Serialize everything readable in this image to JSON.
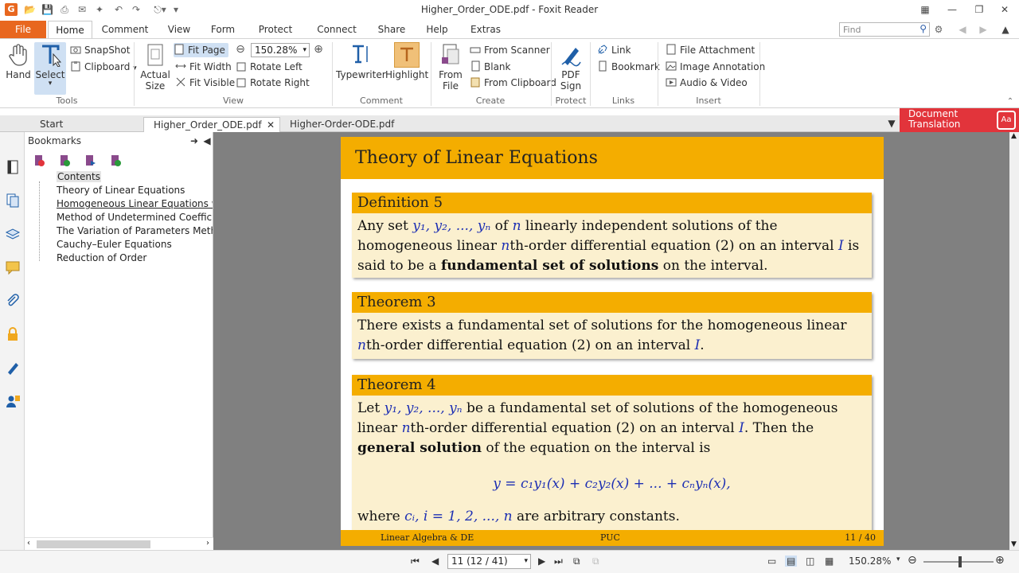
{
  "window": {
    "title": "Higher_Order_ODE.pdf - Foxit Reader"
  },
  "ribbon_tabs": [
    "File",
    "Home",
    "Comment",
    "View",
    "Form",
    "Protect",
    "Connect",
    "Share",
    "Help",
    "Extras"
  ],
  "search": {
    "placeholder": "Find"
  },
  "ribbon": {
    "hand": "Hand",
    "select": "Select",
    "snapshot": "SnapShot",
    "clipboard": "Clipboard",
    "tools_label": "Tools",
    "actual_size": "Actual Size",
    "fit_page": "Fit Page",
    "fit_width": "Fit Width",
    "fit_visible": "Fit Visible",
    "zoom": "150.28%",
    "rotate_left": "Rotate Left",
    "rotate_right": "Rotate Right",
    "view_label": "View",
    "typewriter": "Typewriter",
    "highlight": "Highlight",
    "comment_label": "Comment",
    "from_file": "From File",
    "from_scanner": "From Scanner",
    "blank": "Blank",
    "from_clipboard": "From Clipboard",
    "create_label": "Create",
    "pdf_sign": "PDF Sign",
    "protect_label": "Protect",
    "link": "Link",
    "bookmark": "Bookmark",
    "links_label": "Links",
    "file_attachment": "File Attachment",
    "image_annotation": "Image Annotation",
    "audio_video": "Audio & Video",
    "insert_label": "Insert"
  },
  "doc_tabs": [
    "Start",
    "Higher_Order_ODE.pdf",
    "Higher-Order-ODE.pdf"
  ],
  "translate": {
    "line1": "Document",
    "line2": "Translation"
  },
  "bookmarks": {
    "header": "Bookmarks",
    "items": [
      "Contents",
      "Theory of Linear Equations",
      "Homogeneous Linear Equations with C",
      "Method of Undetermined Coefficients",
      "The Variation of Parameters Method",
      "Cauchy–Euler Equations",
      "Reduction of Order"
    ]
  },
  "page": {
    "title": "Theory of Linear Equations",
    "def5": {
      "heading": "Definition 5",
      "t1": "Any set ",
      "m1": "y₁, y₂, ..., yₙ",
      "t2": " of ",
      "m2": "n",
      "t3": " linearly independent solutions of the homogeneous linear ",
      "m3": "n",
      "t4": "th-order differential equation (2) on an interval ",
      "m4": "I",
      "t5": " is said to be a ",
      "bold": "fundamental set of solutions",
      "t6": " on the interval."
    },
    "thm3": {
      "heading": "Theorem 3",
      "t1": "There exists a fundamental set of solutions for the homogeneous linear ",
      "m1": "n",
      "t2": "th-order differential equation (2) on an interval ",
      "m2": "I",
      "t3": "."
    },
    "thm4": {
      "heading": "Theorem 4",
      "t1": "Let ",
      "m1": "y₁, y₂, ..., yₙ",
      "t2": " be a fundamental set of solutions of the homogeneous linear ",
      "m2": "n",
      "t3": "th-order differential equation (2) on an interval ",
      "m3": "I",
      "t4": ". Then the ",
      "bold": "general solution",
      "t5": " of the equation on the interval is",
      "equation": "y = c₁y₁(x) + c₂y₂(x) + ... + cₙyₙ(x),",
      "t6": "where ",
      "m4": "cᵢ, i = 1, 2, ..., n",
      "t7": " are arbitrary constants."
    },
    "footer": {
      "left": "Linear Algebra & DE",
      "center": "PUC",
      "right": "11 / 40"
    }
  },
  "status": {
    "page_indicator": "11 (12 / 41)",
    "zoom": "150.28%"
  }
}
